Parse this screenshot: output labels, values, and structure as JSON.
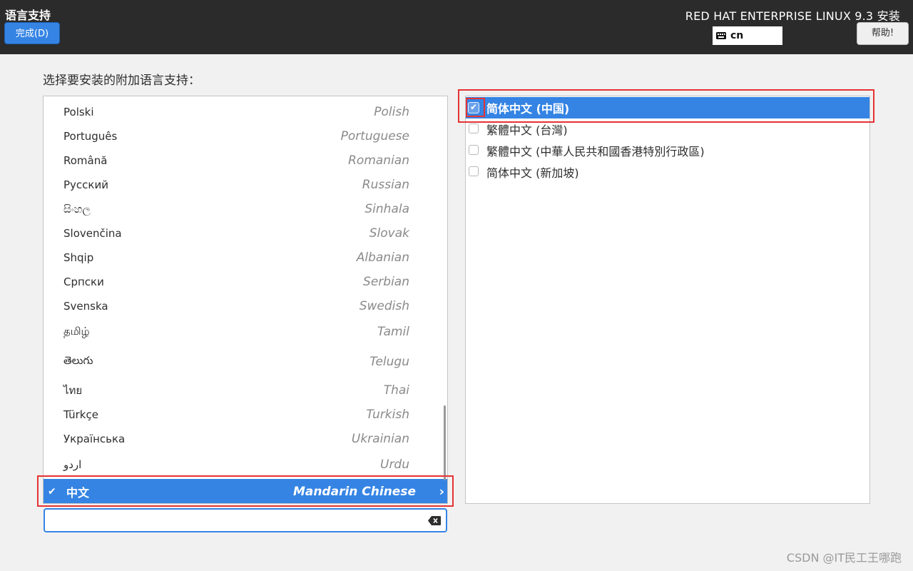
{
  "header": {
    "title": "语言支持",
    "done_label": "完成(D)",
    "product": "RED HAT ENTERPRISE LINUX 9.3 安装",
    "keyboard_layout": "cn",
    "help_label": "帮助!"
  },
  "main": {
    "prompt": "选择要安装的附加语言支持：",
    "languages": [
      {
        "native": "Polski",
        "english": "Polish"
      },
      {
        "native": "Português",
        "english": "Portuguese"
      },
      {
        "native": "Română",
        "english": "Romanian"
      },
      {
        "native": "Русский",
        "english": "Russian"
      },
      {
        "native": "සිංහල",
        "english": "Sinhala"
      },
      {
        "native": "Slovenčina",
        "english": "Slovak"
      },
      {
        "native": "Shqip",
        "english": "Albanian"
      },
      {
        "native": "Српски",
        "english": "Serbian"
      },
      {
        "native": "Svenska",
        "english": "Swedish"
      },
      {
        "native": "தமிழ்",
        "english": "Tamil"
      },
      {
        "native": "తెలుగు",
        "english": "Telugu"
      },
      {
        "native": "ไทย",
        "english": "Thai"
      },
      {
        "native": "Türkçe",
        "english": "Turkish"
      },
      {
        "native": "Українська",
        "english": "Ukrainian"
      },
      {
        "native": "اردو",
        "english": "Urdu"
      },
      {
        "native": "中文",
        "english": "Mandarin Chinese"
      }
    ],
    "search_value": "",
    "locales": [
      {
        "label": "简体中文 (中国)",
        "checked": true
      },
      {
        "label": "繁體中文 (台灣)",
        "checked": false
      },
      {
        "label": "繁體中文 (中華人民共和國香港特別行政區)",
        "checked": false
      },
      {
        "label": "简体中文 (新加坡)",
        "checked": false
      }
    ]
  },
  "watermark": "CSDN @IT民工王哪跑",
  "colors": {
    "header_bg": "#2b2b2b",
    "accent": "#3584e4",
    "annotation_red": "#e53333"
  }
}
